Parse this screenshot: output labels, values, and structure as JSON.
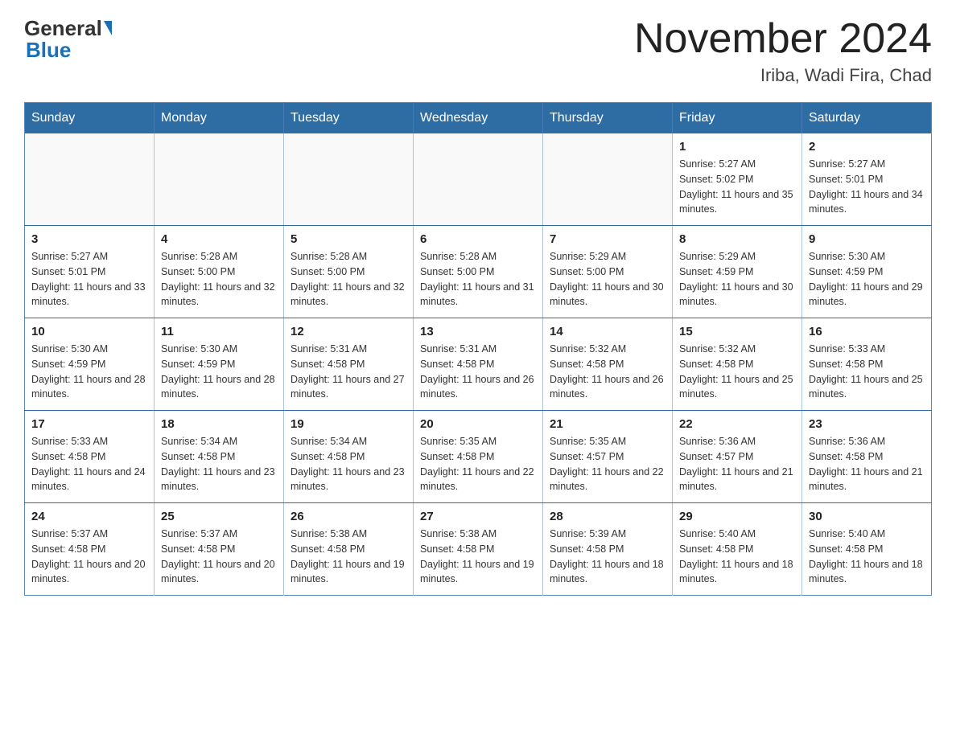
{
  "header": {
    "logo_general": "General",
    "logo_blue": "Blue",
    "month_title": "November 2024",
    "location": "Iriba, Wadi Fira, Chad"
  },
  "days_of_week": [
    "Sunday",
    "Monday",
    "Tuesday",
    "Wednesday",
    "Thursday",
    "Friday",
    "Saturday"
  ],
  "weeks": [
    [
      {
        "day": "",
        "info": ""
      },
      {
        "day": "",
        "info": ""
      },
      {
        "day": "",
        "info": ""
      },
      {
        "day": "",
        "info": ""
      },
      {
        "day": "",
        "info": ""
      },
      {
        "day": "1",
        "info": "Sunrise: 5:27 AM\nSunset: 5:02 PM\nDaylight: 11 hours and 35 minutes."
      },
      {
        "day": "2",
        "info": "Sunrise: 5:27 AM\nSunset: 5:01 PM\nDaylight: 11 hours and 34 minutes."
      }
    ],
    [
      {
        "day": "3",
        "info": "Sunrise: 5:27 AM\nSunset: 5:01 PM\nDaylight: 11 hours and 33 minutes."
      },
      {
        "day": "4",
        "info": "Sunrise: 5:28 AM\nSunset: 5:00 PM\nDaylight: 11 hours and 32 minutes."
      },
      {
        "day": "5",
        "info": "Sunrise: 5:28 AM\nSunset: 5:00 PM\nDaylight: 11 hours and 32 minutes."
      },
      {
        "day": "6",
        "info": "Sunrise: 5:28 AM\nSunset: 5:00 PM\nDaylight: 11 hours and 31 minutes."
      },
      {
        "day": "7",
        "info": "Sunrise: 5:29 AM\nSunset: 5:00 PM\nDaylight: 11 hours and 30 minutes."
      },
      {
        "day": "8",
        "info": "Sunrise: 5:29 AM\nSunset: 4:59 PM\nDaylight: 11 hours and 30 minutes."
      },
      {
        "day": "9",
        "info": "Sunrise: 5:30 AM\nSunset: 4:59 PM\nDaylight: 11 hours and 29 minutes."
      }
    ],
    [
      {
        "day": "10",
        "info": "Sunrise: 5:30 AM\nSunset: 4:59 PM\nDaylight: 11 hours and 28 minutes."
      },
      {
        "day": "11",
        "info": "Sunrise: 5:30 AM\nSunset: 4:59 PM\nDaylight: 11 hours and 28 minutes."
      },
      {
        "day": "12",
        "info": "Sunrise: 5:31 AM\nSunset: 4:58 PM\nDaylight: 11 hours and 27 minutes."
      },
      {
        "day": "13",
        "info": "Sunrise: 5:31 AM\nSunset: 4:58 PM\nDaylight: 11 hours and 26 minutes."
      },
      {
        "day": "14",
        "info": "Sunrise: 5:32 AM\nSunset: 4:58 PM\nDaylight: 11 hours and 26 minutes."
      },
      {
        "day": "15",
        "info": "Sunrise: 5:32 AM\nSunset: 4:58 PM\nDaylight: 11 hours and 25 minutes."
      },
      {
        "day": "16",
        "info": "Sunrise: 5:33 AM\nSunset: 4:58 PM\nDaylight: 11 hours and 25 minutes."
      }
    ],
    [
      {
        "day": "17",
        "info": "Sunrise: 5:33 AM\nSunset: 4:58 PM\nDaylight: 11 hours and 24 minutes."
      },
      {
        "day": "18",
        "info": "Sunrise: 5:34 AM\nSunset: 4:58 PM\nDaylight: 11 hours and 23 minutes."
      },
      {
        "day": "19",
        "info": "Sunrise: 5:34 AM\nSunset: 4:58 PM\nDaylight: 11 hours and 23 minutes."
      },
      {
        "day": "20",
        "info": "Sunrise: 5:35 AM\nSunset: 4:58 PM\nDaylight: 11 hours and 22 minutes."
      },
      {
        "day": "21",
        "info": "Sunrise: 5:35 AM\nSunset: 4:57 PM\nDaylight: 11 hours and 22 minutes."
      },
      {
        "day": "22",
        "info": "Sunrise: 5:36 AM\nSunset: 4:57 PM\nDaylight: 11 hours and 21 minutes."
      },
      {
        "day": "23",
        "info": "Sunrise: 5:36 AM\nSunset: 4:58 PM\nDaylight: 11 hours and 21 minutes."
      }
    ],
    [
      {
        "day": "24",
        "info": "Sunrise: 5:37 AM\nSunset: 4:58 PM\nDaylight: 11 hours and 20 minutes."
      },
      {
        "day": "25",
        "info": "Sunrise: 5:37 AM\nSunset: 4:58 PM\nDaylight: 11 hours and 20 minutes."
      },
      {
        "day": "26",
        "info": "Sunrise: 5:38 AM\nSunset: 4:58 PM\nDaylight: 11 hours and 19 minutes."
      },
      {
        "day": "27",
        "info": "Sunrise: 5:38 AM\nSunset: 4:58 PM\nDaylight: 11 hours and 19 minutes."
      },
      {
        "day": "28",
        "info": "Sunrise: 5:39 AM\nSunset: 4:58 PM\nDaylight: 11 hours and 18 minutes."
      },
      {
        "day": "29",
        "info": "Sunrise: 5:40 AM\nSunset: 4:58 PM\nDaylight: 11 hours and 18 minutes."
      },
      {
        "day": "30",
        "info": "Sunrise: 5:40 AM\nSunset: 4:58 PM\nDaylight: 11 hours and 18 minutes."
      }
    ]
  ]
}
